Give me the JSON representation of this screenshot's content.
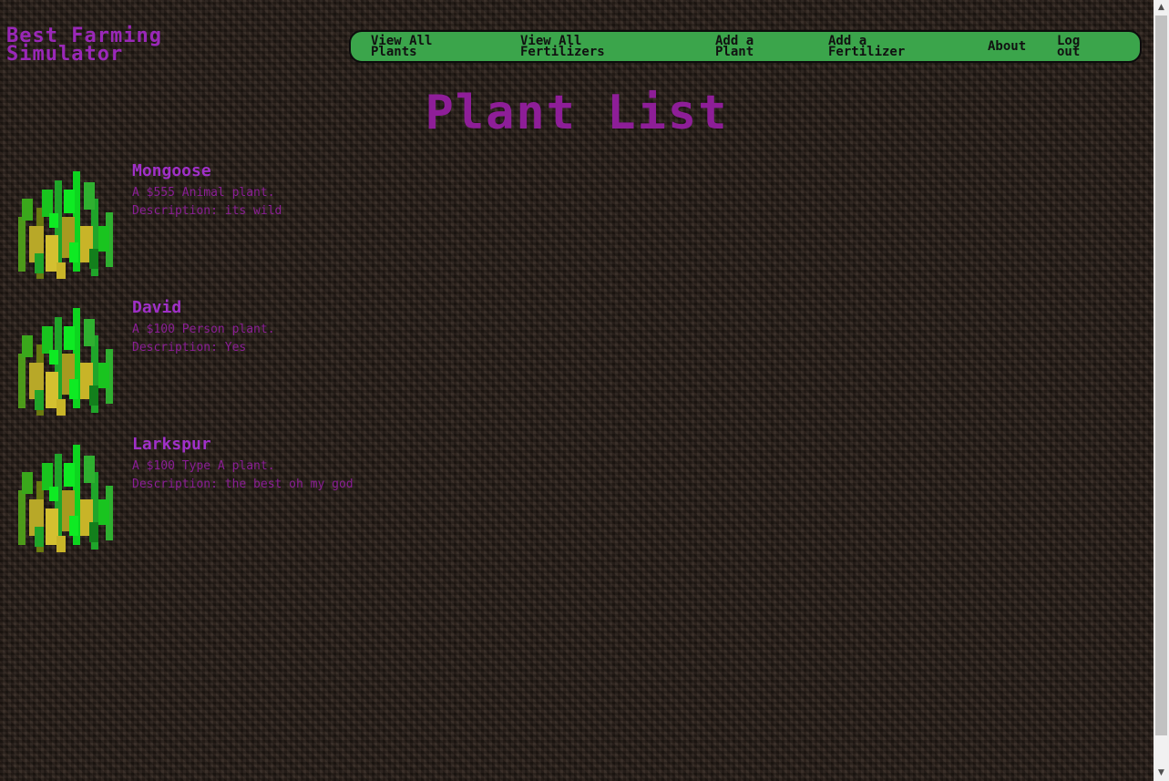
{
  "site": {
    "title": "Best Farming\nSimulator"
  },
  "nav": {
    "items": [
      {
        "label": "View All\nPlants"
      },
      {
        "label": "View All\nFertilizers"
      },
      {
        "label": "Add a\nPlant"
      },
      {
        "label": "Add a\nFertilizer"
      },
      {
        "label": "About"
      },
      {
        "label": "Log\nout"
      }
    ]
  },
  "main": {
    "heading": "Plant List",
    "plants": [
      {
        "name": "Mongoose",
        "summary": "A $555 Animal plant.",
        "description": "Description: its wild"
      },
      {
        "name": "David",
        "summary": "A $100 Person plant.",
        "description": "Description: Yes"
      },
      {
        "name": "Larkspur",
        "summary": "A $100 Type A plant.",
        "description": "Description: the best oh my god"
      }
    ]
  },
  "colors": {
    "accent_purple": "#8e1e98",
    "nav_green": "#3ba54b",
    "background_soil": "#2a201a"
  },
  "icons": {
    "plant_image": "wheat-crop-icon",
    "scroll_up": "triangle-up-icon",
    "scroll_down": "triangle-down-icon"
  }
}
